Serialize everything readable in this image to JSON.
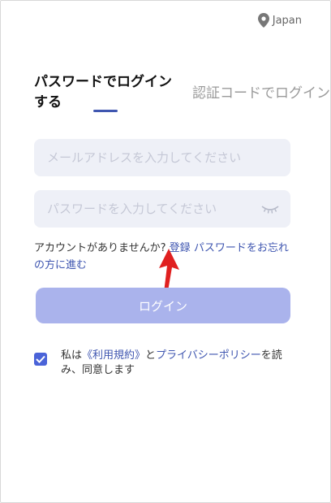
{
  "region": {
    "label": "Japan",
    "icon": "location-pin-icon"
  },
  "tabs": {
    "password_login": "パスワードでログインする",
    "code_login": "認証コードでログイン"
  },
  "form": {
    "email_placeholder": "メールアドレスを入力してください",
    "password_placeholder": "パスワードを入力してください",
    "password_toggle_icon": "eye-closed-icon"
  },
  "links": {
    "no_account": "アカウントがありませんか?",
    "register": "登録",
    "forgot_password": "パスワードをお忘れの方に進む"
  },
  "login_button": "ログイン",
  "agreement": {
    "checked": true,
    "prefix": "私は",
    "terms": "《利用規約》",
    "and": "と",
    "privacy": "プライバシーポリシー",
    "suffix": "を読み、同意します"
  },
  "annotation": {
    "arrow_color": "#e02020"
  },
  "colors": {
    "accent": "#3f56b0",
    "button": "#aab3ec",
    "field_bg": "#eef0f7",
    "checkbox": "#4a63d8"
  }
}
